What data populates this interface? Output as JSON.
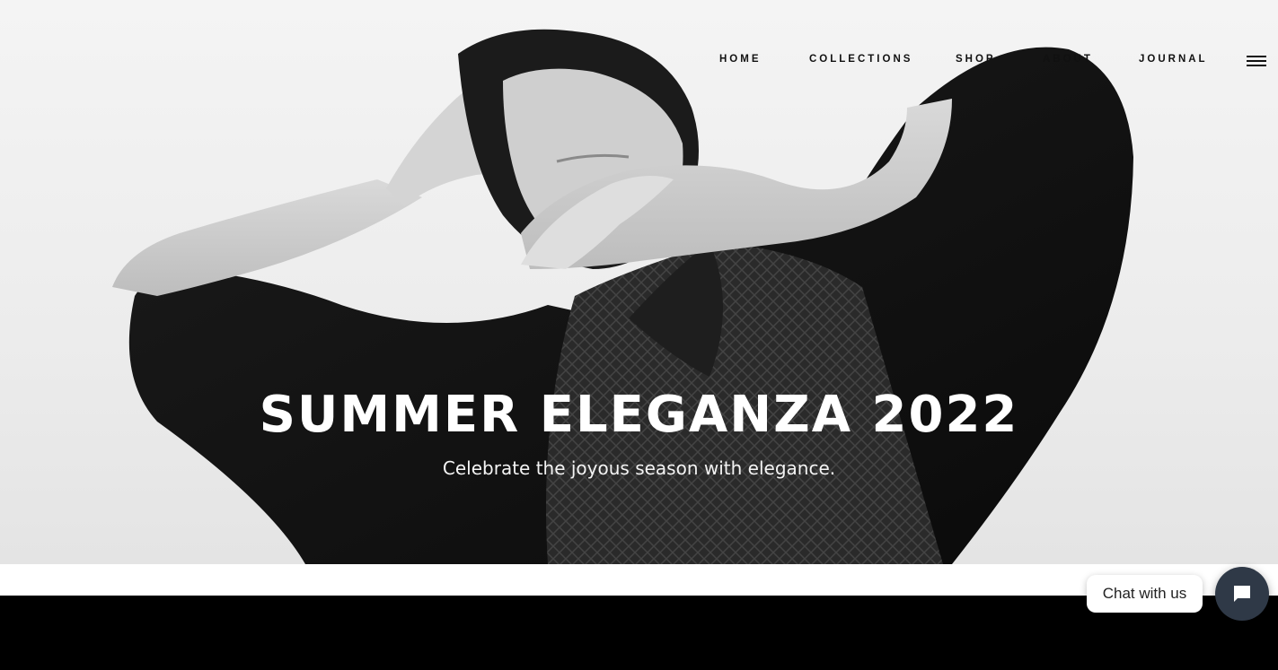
{
  "nav": {
    "items": [
      {
        "label": "HOME"
      },
      {
        "label": "COLLECTIONS"
      },
      {
        "label": "SHOP"
      },
      {
        "label": "ABOUT"
      },
      {
        "label": "JOURNAL"
      }
    ],
    "menu_icon": "hamburger-menu-icon"
  },
  "hero": {
    "title": "SUMMER ELEGANZA 2022",
    "subtitle": "Celebrate the joyous season with elegance.",
    "image": "black-and-white-photo-of-woman-covering-face-with-hands"
  },
  "chat": {
    "bubble_label": "Chat with us",
    "button_icon": "chat-icon"
  },
  "colors": {
    "nav_text": "#111111",
    "hero_text": "#ffffff",
    "footer_bg": "#000000",
    "chat_button_bg": "#2f3947"
  }
}
